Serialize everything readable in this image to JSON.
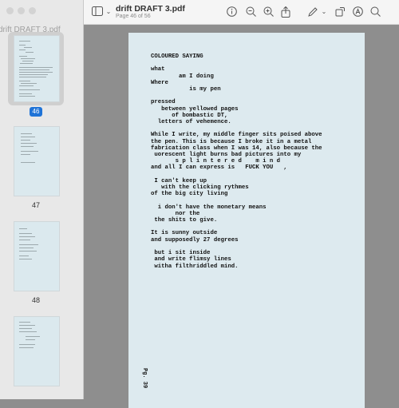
{
  "window": {
    "sidebar_title": "drift DRAFT 3.pdf",
    "doc_title": "drift DRAFT 3.pdf",
    "doc_subtitle": "Page 46 of 56"
  },
  "sidebar": {
    "thumbnails": [
      {
        "page": "46",
        "selected": true
      },
      {
        "page": "47",
        "selected": false
      },
      {
        "page": "48",
        "selected": false
      },
      {
        "page": "",
        "selected": false
      }
    ]
  },
  "toolbar": {
    "icons": [
      "sidebar-toggle-icon",
      "info-icon",
      "zoom-out-icon",
      "zoom-in-icon",
      "share-icon",
      "markup-pen-icon",
      "chevron-down-icon",
      "rotate-icon",
      "markup-icon",
      "search-icon"
    ]
  },
  "page": {
    "lines": [
      "COLOURED SAYING",
      "",
      "what",
      "        am I doing",
      "Where",
      "           is my pen",
      "",
      "pressed",
      "   between yellowed pages",
      "      of bombastic DT,",
      "  letters of vehemence.",
      "",
      "While I write, my middle finger sits poised above",
      "the pen. This is because I broke it in a metal",
      "fabrication class when I was 14, also because the",
      " uorescent light burns bad pictures into my",
      "       s p l i n t e r e d    m i n d",
      "and all I can express is   FUCK YOU   ,",
      "",
      " I can't keep up",
      "   with the clicking rythmes",
      "of the big city living",
      "",
      "  i don't have the monetary means",
      "       nor the",
      " the shits to give.",
      "",
      "It is sunny outside",
      "and supposedly 27 degrees",
      "",
      " but i sit inside",
      " and write flimsy lines",
      " witha filthriddled mind."
    ],
    "footer": "Pg. 39"
  }
}
